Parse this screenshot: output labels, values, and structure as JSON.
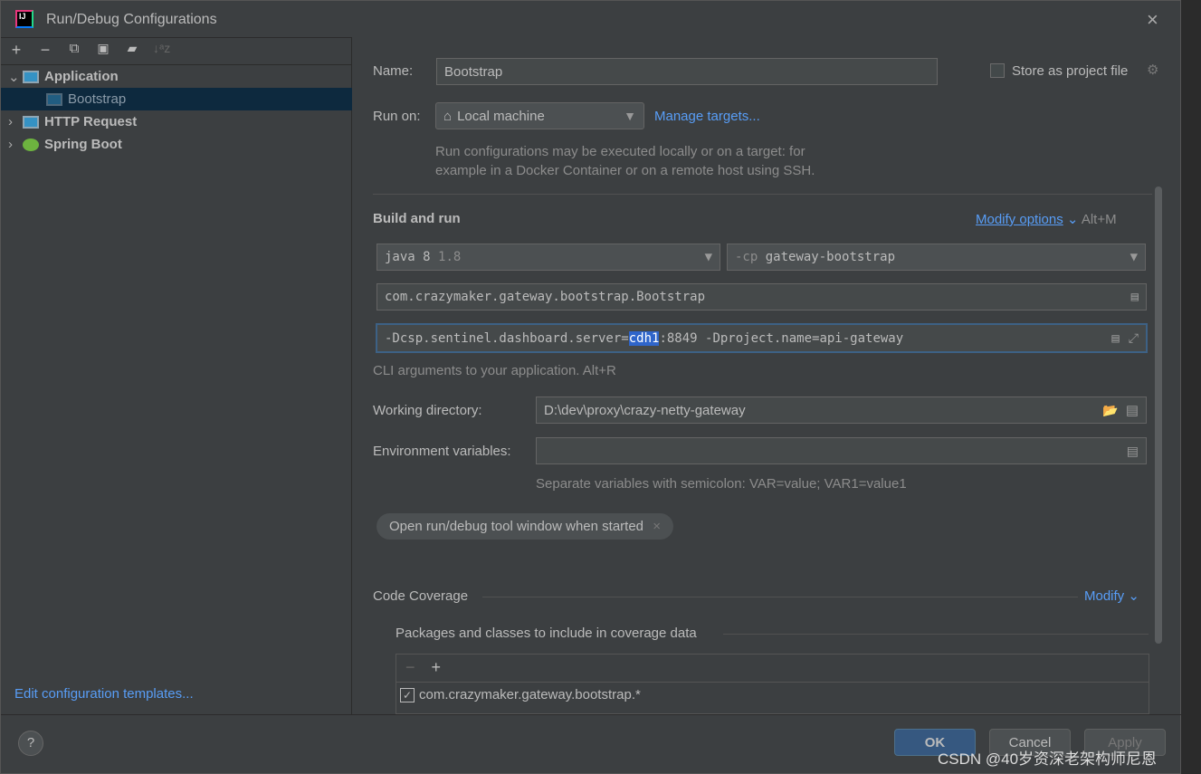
{
  "window": {
    "title": "Run/Debug Configurations"
  },
  "toolbar": {
    "add": "+",
    "remove": "−",
    "copy": "⧉",
    "save": "💾",
    "folder": "📁",
    "sort": "↓ᵃz"
  },
  "tree": [
    {
      "label": "Application",
      "expanded": true,
      "children": [
        {
          "label": "Bootstrap",
          "selected": true
        }
      ]
    },
    {
      "label": "HTTP Request",
      "expanded": false
    },
    {
      "label": "Spring Boot",
      "expanded": false
    }
  ],
  "left_footer": {
    "templates_link": "Edit configuration templates..."
  },
  "form": {
    "name_label": "Name:",
    "name_value": "Bootstrap",
    "store_label": "Store as project file",
    "store_checked": false,
    "run_on_label": "Run on:",
    "run_on_value": "Local machine",
    "manage_targets": "Manage targets...",
    "run_on_hint_1": "Run configurations may be executed locally or on a target: for",
    "run_on_hint_2": "example in a Docker Container or on a remote host using SSH.",
    "build_run": "Build and run",
    "modify_options": "Modify options",
    "modify_shortcut": "Alt+M",
    "jdk_name": "java 8",
    "jdk_version": "1.8",
    "cp_prefix": "-cp",
    "cp_value": "gateway-bootstrap",
    "main_class": "com.crazymaker.gateway.bootstrap.Bootstrap",
    "args_pre": "-Dcsp.sentinel.dashboard.server=",
    "args_sel": "cdh1",
    "args_post": ":8849 -Dproject.name=api-gateway",
    "args_hint": "CLI arguments to your application. Alt+R",
    "workdir_label": "Working directory:",
    "workdir_value": "D:\\dev\\proxy\\crazy-netty-gateway",
    "env_label": "Environment variables:",
    "env_value": "",
    "env_hint": "Separate variables with semicolon: VAR=value; VAR1=value1",
    "chip": "Open run/debug tool window when started",
    "coverage": "Code Coverage",
    "coverage_modify": "Modify",
    "packages_label": "Packages and classes to include in coverage data",
    "coverage_item": "com.crazymaker.gateway.bootstrap.*",
    "coverage_item_checked": true
  },
  "buttons": {
    "help": "?",
    "ok": "OK",
    "cancel": "Cancel",
    "apply": "Apply"
  },
  "watermark": "CSDN @40岁资深老架构师尼恩",
  "colors": {
    "accent": "#589df6",
    "selection": "#0d293e",
    "ok": "#365880"
  }
}
